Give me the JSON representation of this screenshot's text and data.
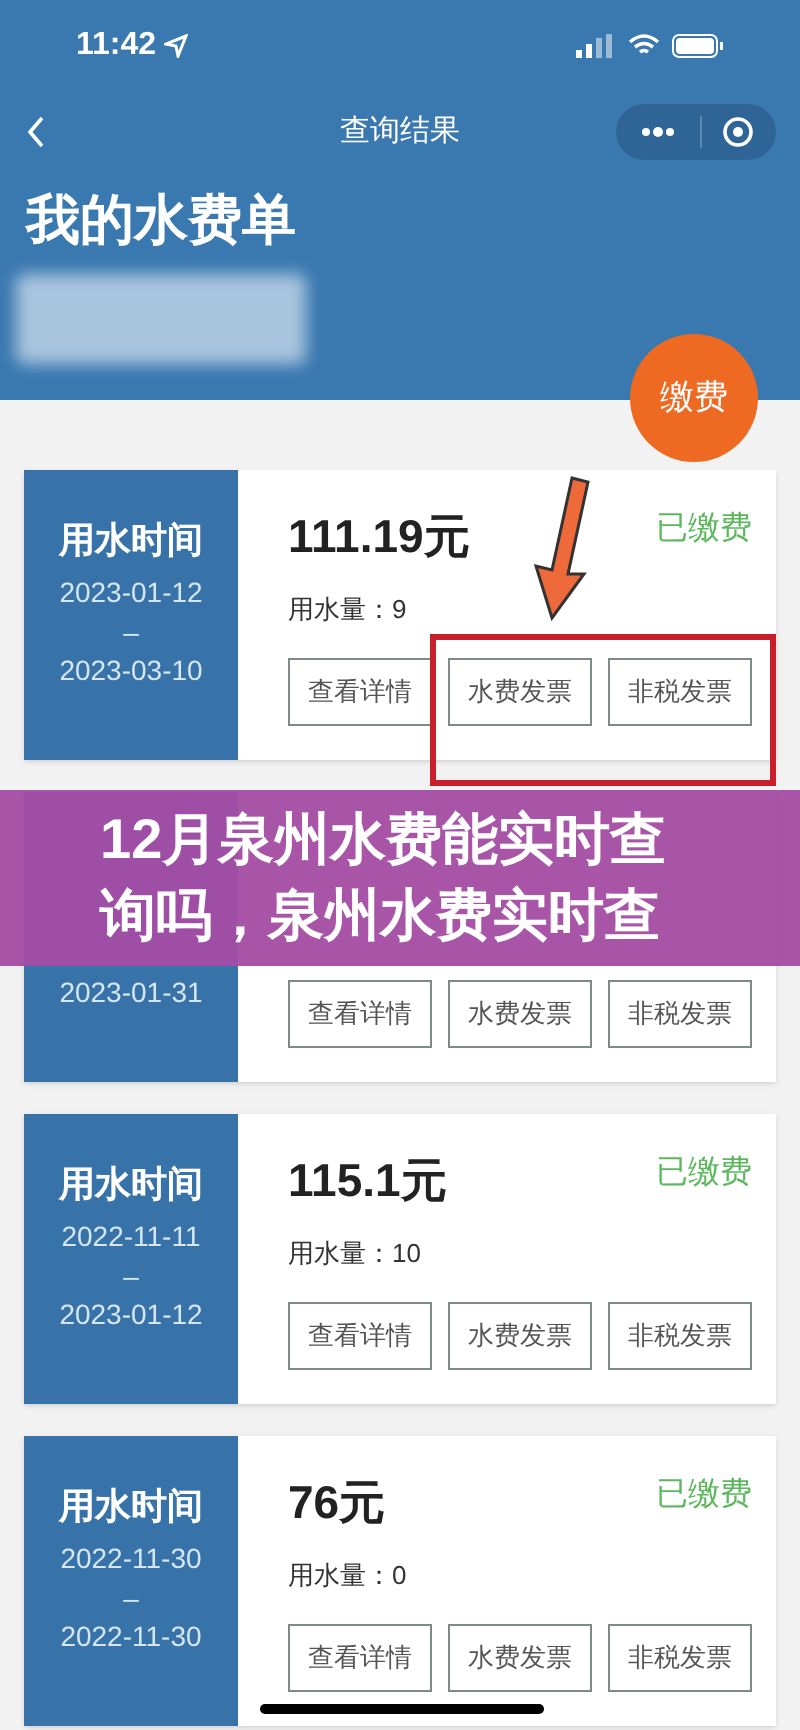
{
  "status_bar": {
    "time": "11:42"
  },
  "nav": {
    "title": "查询结果"
  },
  "header": {
    "title": "我的水费单"
  },
  "pay_button": {
    "label": "缴费"
  },
  "bills": [
    {
      "label": "用水时间",
      "date_start": "2023-01-12",
      "separator": "–",
      "date_end": "2023-03-10",
      "amount": "111.19元",
      "usage": "用水量：9",
      "status": "已缴费",
      "buttons": [
        "查看详情",
        "水费发票",
        "非税发票"
      ]
    },
    {
      "date_end": "2023-01-31",
      "buttons": [
        "查看详情",
        "水费发票",
        "非税发票"
      ]
    },
    {
      "label": "用水时间",
      "date_start": "2022-11-11",
      "separator": "–",
      "date_end": "2023-01-12",
      "amount": "115.1元",
      "usage": "用水量：10",
      "status": "已缴费",
      "buttons": [
        "查看详情",
        "水费发票",
        "非税发票"
      ]
    },
    {
      "label": "用水时间",
      "date_start": "2022-11-30",
      "separator": "–",
      "date_end": "2022-11-30",
      "amount": "76元",
      "usage": "用水量：0",
      "status": "已缴费",
      "buttons": [
        "查看详情",
        "水费发票",
        "非税发票"
      ]
    }
  ],
  "banner": {
    "lines": [
      "12月泉州水费能实时查",
      "询吗，泉州水费实时查"
    ]
  }
}
